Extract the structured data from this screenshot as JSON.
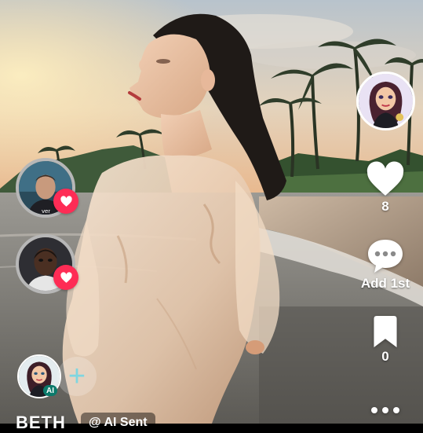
{
  "actions": {
    "likes": "8",
    "comments": "Add 1st",
    "saves": "0"
  },
  "creator": {
    "name": "BETH",
    "handle": "@ AI Sent",
    "ai_badge": "AI",
    "follow_symbol": "+"
  },
  "colors": {
    "heart_badge": "#fe2c55",
    "follow_plus": "#7fd6e0",
    "ai_badge": "#0b7a6b"
  }
}
